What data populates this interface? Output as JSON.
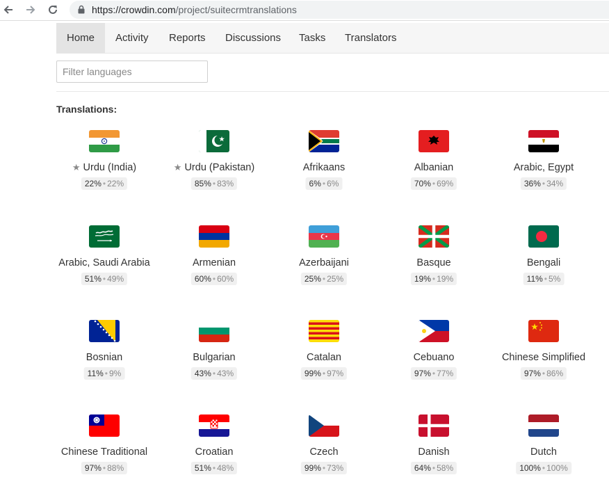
{
  "browser": {
    "url_host": "https://crowdin.com",
    "url_path": "/project/suitecrmtranslations"
  },
  "tabs": [
    "Home",
    "Activity",
    "Reports",
    "Discussions",
    "Tasks",
    "Translators"
  ],
  "filter": {
    "placeholder": "Filter languages"
  },
  "section_title": "Translations:",
  "languages": [
    {
      "name": "Urdu (India)",
      "starred": true,
      "translated": "22%",
      "approved": "22%",
      "flag": "india"
    },
    {
      "name": "Urdu (Pakistan)",
      "starred": true,
      "translated": "85%",
      "approved": "83%",
      "flag": "pakistan"
    },
    {
      "name": "Afrikaans",
      "starred": false,
      "translated": "6%",
      "approved": "6%",
      "flag": "south-africa"
    },
    {
      "name": "Albanian",
      "starred": false,
      "translated": "70%",
      "approved": "69%",
      "flag": "albania"
    },
    {
      "name": "Arabic, Egypt",
      "starred": false,
      "translated": "36%",
      "approved": "34%",
      "flag": "egypt"
    },
    {
      "name": "Arabic, Saudi Arabia",
      "starred": false,
      "translated": "51%",
      "approved": "49%",
      "flag": "saudi-arabia"
    },
    {
      "name": "Armenian",
      "starred": false,
      "translated": "60%",
      "approved": "60%",
      "flag": "armenia"
    },
    {
      "name": "Azerbaijani",
      "starred": false,
      "translated": "25%",
      "approved": "25%",
      "flag": "azerbaijan"
    },
    {
      "name": "Basque",
      "starred": false,
      "translated": "19%",
      "approved": "19%",
      "flag": "basque"
    },
    {
      "name": "Bengali",
      "starred": false,
      "translated": "11%",
      "approved": "5%",
      "flag": "bangladesh"
    },
    {
      "name": "Bosnian",
      "starred": false,
      "translated": "11%",
      "approved": "9%",
      "flag": "bosnia"
    },
    {
      "name": "Bulgarian",
      "starred": false,
      "translated": "43%",
      "approved": "43%",
      "flag": "bulgaria"
    },
    {
      "name": "Catalan",
      "starred": false,
      "translated": "99%",
      "approved": "97%",
      "flag": "catalonia"
    },
    {
      "name": "Cebuano",
      "starred": false,
      "translated": "97%",
      "approved": "77%",
      "flag": "philippines"
    },
    {
      "name": "Chinese Simplified",
      "starred": false,
      "translated": "97%",
      "approved": "86%",
      "flag": "china"
    },
    {
      "name": "Chinese Traditional",
      "starred": false,
      "translated": "97%",
      "approved": "88%",
      "flag": "taiwan"
    },
    {
      "name": "Croatian",
      "starred": false,
      "translated": "51%",
      "approved": "48%",
      "flag": "croatia"
    },
    {
      "name": "Czech",
      "starred": false,
      "translated": "99%",
      "approved": "73%",
      "flag": "czech"
    },
    {
      "name": "Danish",
      "starred": false,
      "translated": "64%",
      "approved": "58%",
      "flag": "denmark"
    },
    {
      "name": "Dutch",
      "starred": false,
      "translated": "100%",
      "approved": "100%",
      "flag": "netherlands"
    }
  ]
}
